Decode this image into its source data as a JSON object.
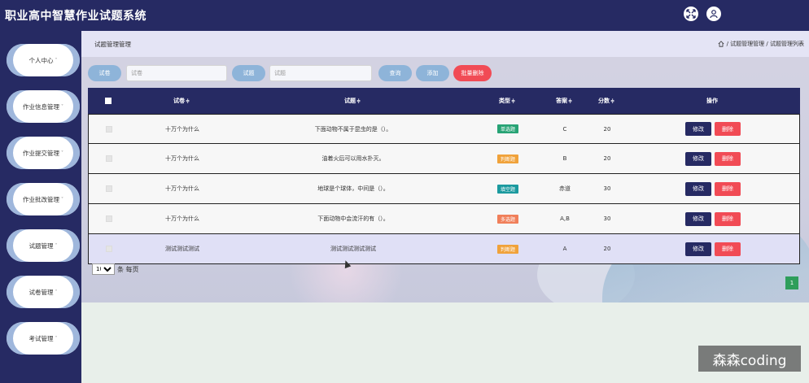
{
  "app": {
    "title": "职业高中智慧作业试题系统"
  },
  "header_icons": [
    {
      "icon": "fullscreen-icon"
    },
    {
      "icon": "user-icon"
    }
  ],
  "sidebar": {
    "items": [
      {
        "label": "个人中心"
      },
      {
        "label": "作业信息管理"
      },
      {
        "label": "作业提交管理"
      },
      {
        "label": "作业批改管理"
      },
      {
        "label": "试题管理"
      },
      {
        "label": "试卷管理"
      },
      {
        "label": "考试管理"
      }
    ],
    "caret": "˅"
  },
  "page": {
    "title": "试题管理管理",
    "breadcrumb": "/ 试题管理管理 / 试题管理列表"
  },
  "search": {
    "paper_label": "试卷",
    "paper_placeholder": "试卷",
    "question_label": "试题",
    "question_placeholder": "试题",
    "query_btn": "查询",
    "add_btn": "添加",
    "batch_delete_btn": "批量删除"
  },
  "table": {
    "columns": [
      "试卷",
      "试题",
      "类型",
      "答案",
      "分数",
      "操作"
    ],
    "sort_mark": "≑",
    "rows": [
      {
        "paper": "十万个为什么",
        "question": "下面动物不属于昆虫的是（）。",
        "type": "单选题",
        "type_color": "#27a375",
        "answer": "C",
        "score": "20"
      },
      {
        "paper": "十万个为什么",
        "question": "油着火后可以用水扑灭。",
        "type": "判断题",
        "type_color": "#f0a23a",
        "answer": "B",
        "score": "20"
      },
      {
        "paper": "十万个为什么",
        "question": "地球是个球体，中间是（）。",
        "type": "填空题",
        "type_color": "#1b9a9f",
        "answer": "赤道",
        "score": "30"
      },
      {
        "paper": "十万个为什么",
        "question": "下面动物中会流汗的有（）。",
        "type": "多选题",
        "type_color": "#f07f5a",
        "answer": "A,B",
        "score": "30"
      },
      {
        "paper": "测试测试测试",
        "question": "测试测试测试测试",
        "type": "判断题",
        "type_color": "#f0a23a",
        "answer": "A",
        "score": "20"
      }
    ],
    "edit_btn": "修改",
    "delete_btn": "删除"
  },
  "pagination": {
    "page_size": "10",
    "page_size_label": "条 每页",
    "current_page": "1"
  },
  "watermark": "森森coding"
}
